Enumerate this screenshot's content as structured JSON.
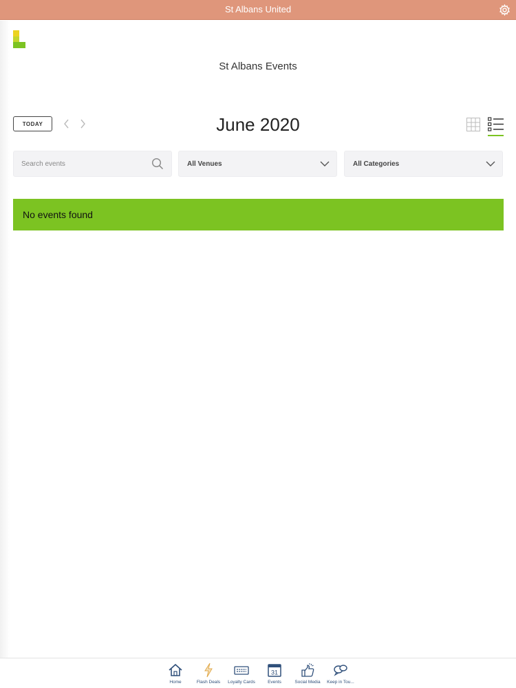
{
  "app": {
    "title": "St Albans United"
  },
  "header": {
    "heading": "St Albans Events"
  },
  "calendar": {
    "today_label": "TODAY",
    "month_title": "June 2020",
    "prev_icon": "chevron-left-icon",
    "next_icon": "chevron-right-icon",
    "views": [
      "grid-view-icon",
      "list-view-icon"
    ],
    "active_view": "list"
  },
  "filters": {
    "search_placeholder": "Search events",
    "search_value": "",
    "venue_selected": "All Venues",
    "category_selected": "All Categories"
  },
  "notice": {
    "message": "No events found"
  },
  "bottom_nav": {
    "items": [
      {
        "label": "Home",
        "icon": "home-icon"
      },
      {
        "label": "Flash Deals",
        "icon": "lightning-icon"
      },
      {
        "label": "Loyalty Cards",
        "icon": "loyalty-card-icon"
      },
      {
        "label": "Events",
        "icon": "calendar-icon",
        "badge": "31"
      },
      {
        "label": "Social Media",
        "icon": "thumbs-up-icon"
      },
      {
        "label": "Keep in Tou...",
        "icon": "chat-bubbles-icon"
      }
    ]
  },
  "colors": {
    "topbar": "#df967b",
    "accent_green": "#7cc322",
    "logo_yellow": "#ecd320",
    "nav_icon": "#2f4f7a"
  }
}
